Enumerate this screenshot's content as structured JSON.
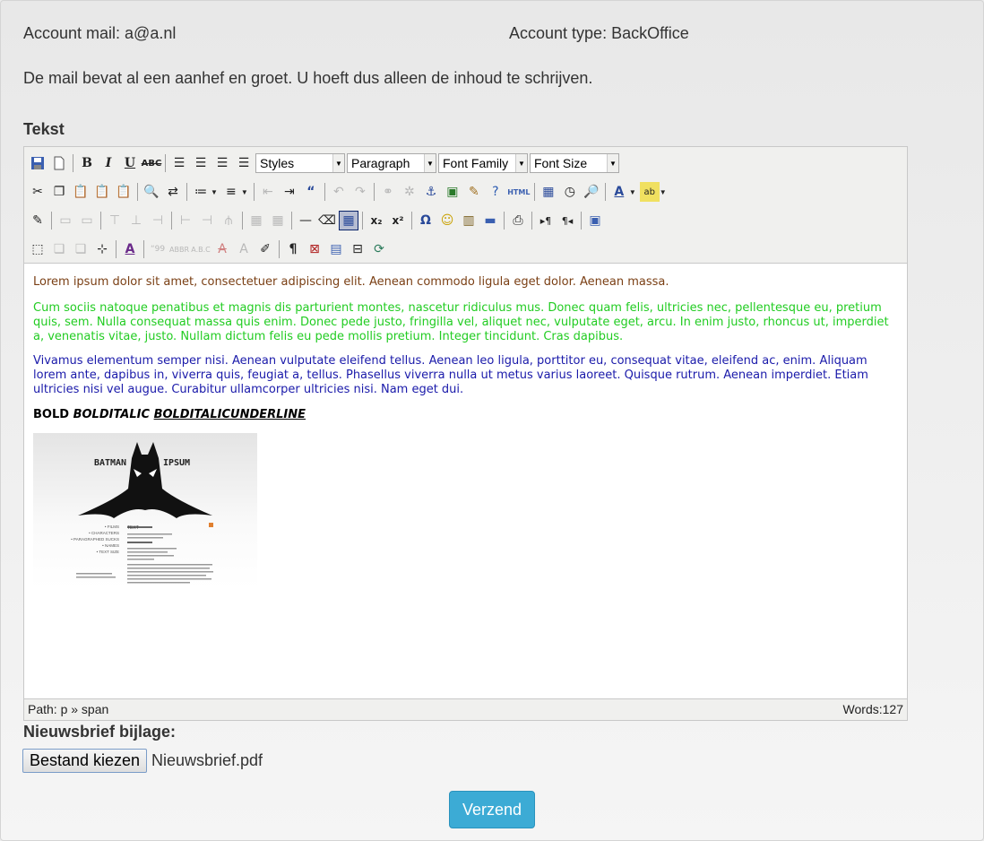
{
  "account": {
    "mail_label": "Account mail: a@a.nl",
    "type_label": "Account type: BackOffice"
  },
  "intro_note": "De mail bevat al een aanhef en groet. U hoeft dus alleen de inhoud te schrijven.",
  "tekst_label": "Tekst",
  "editor": {
    "toolbar": {
      "styles": "Styles",
      "paragraph": "Paragraph",
      "font_family": "Font Family",
      "font_size": "Font Size"
    },
    "content": {
      "p1": "Lorem ipsum dolor sit amet, consectetuer adipiscing elit. Aenean commodo ligula eget dolor. Aenean massa.",
      "p2": "Cum sociis natoque penatibus et magnis dis parturient montes, nascetur ridiculus mus. Donec quam felis, ultricies nec, pellentesque eu, pretium quis, sem. Nulla consequat massa quis enim. Donec pede justo, fringilla vel, aliquet nec, vulputate eget, arcu. In enim justo, rhoncus ut, imperdiet a, venenatis vitae, justo. Nullam dictum felis eu pede mollis pretium. Integer tincidunt. Cras dapibus.",
      "p3": "Vivamus elementum semper nisi. Aenean vulputate eleifend tellus. Aenean leo ligula, porttitor eu, consequat vitae, eleifend ac, enim. Aliquam lorem ante, dapibus in, viverra quis, feugiat a, tellus. Phasellus viverra nulla ut metus varius laoreet. Quisque rutrum. Aenean imperdiet. Etiam ultricies nisi vel augue. Curabitur ullamcorper ultricies nisi. Nam eget dui.",
      "bold": "BOLD",
      "bolditalic": "BOLDITALIC",
      "bolditalicunderline": "BOLDITALICUNDERLINE",
      "image": {
        "title_left": "BATMAN",
        "title_right": "IPSUM",
        "menu": [
          "• FILMS",
          "• CHARACTERS",
          "• PARAGRAPHED SUCKS",
          "• NAMES",
          "• TEXT SIZE"
        ],
        "text_label": "TEXT"
      }
    },
    "status": {
      "path": "Path: p » span",
      "words": "Words:127"
    }
  },
  "attachment": {
    "label": "Nieuwsbrief bijlage:",
    "button": "Bestand kiezen",
    "file_name": "Nieuwsbrief.pdf"
  },
  "submit_label": "Verzend",
  "colors": {
    "p1": "#7a3f14",
    "p2": "#22cc22",
    "p3": "#1a1aaa",
    "submit": "#3cabd5"
  }
}
